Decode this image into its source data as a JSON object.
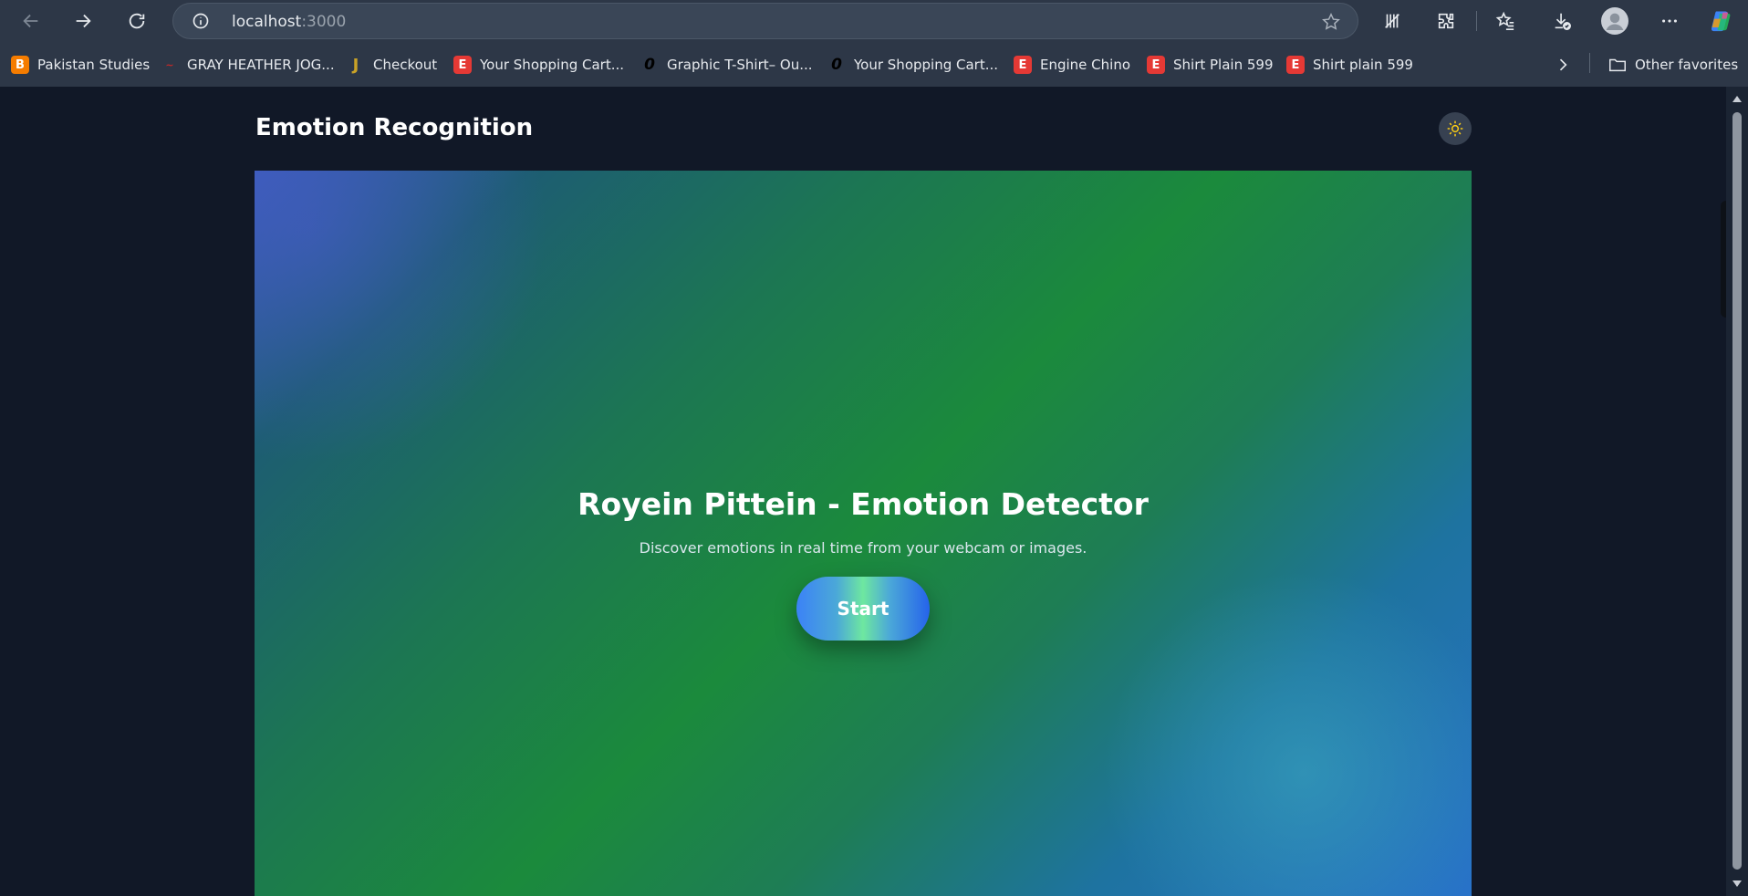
{
  "browser": {
    "url_host": "localhost",
    "url_port": ":3000",
    "bookmarks": [
      {
        "label": "Pakistan Studies",
        "icon": "blogger-icon",
        "color": "#f57c00",
        "glyph": "B"
      },
      {
        "label": "GRAY HEATHER JOG...",
        "icon": "brand-logo-icon",
        "color": "#c62828",
        "glyph": "~"
      },
      {
        "label": "Checkout",
        "icon": "checkout-logo-icon",
        "color": "#c9a227",
        "glyph": "J"
      },
      {
        "label": "Your Shopping Cart...",
        "icon": "e-logo-icon",
        "color": "#e53935",
        "glyph": "E"
      },
      {
        "label": "Graphic T-Shirt– Ou...",
        "icon": "outfitters-logo-icon",
        "color": "#111111",
        "glyph": "0"
      },
      {
        "label": "Your Shopping Cart...",
        "icon": "outfitters-logo-icon",
        "color": "#111111",
        "glyph": "0"
      },
      {
        "label": "Engine Chino",
        "icon": "e-logo-icon",
        "color": "#e53935",
        "glyph": "E"
      },
      {
        "label": "Shirt Plain 599",
        "icon": "e-logo-icon",
        "color": "#e53935",
        "glyph": "E"
      },
      {
        "label": "Shirt plain 599",
        "icon": "e-logo-icon",
        "color": "#e53935",
        "glyph": "E"
      }
    ],
    "other_favorites": "Other favorites"
  },
  "app": {
    "title": "Emotion Recognition",
    "theme_toggle_icon": "sun-icon"
  },
  "hero": {
    "title": "Royein Pittein - Emotion Detector",
    "subtitle": "Discover emotions in real time from your webcam or images.",
    "start_label": "Start"
  },
  "colors": {
    "page_bg": "#111827",
    "chrome_bg": "#2d3747",
    "sun": "#facc15"
  }
}
